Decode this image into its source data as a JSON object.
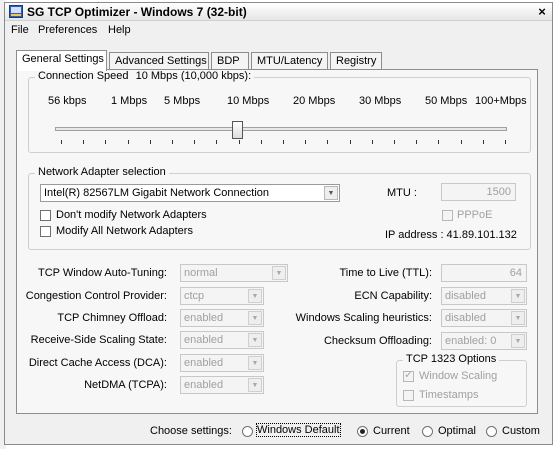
{
  "window": {
    "title": "SG TCP Optimizer - Windows 7 (32-bit)",
    "close_glyph": "×"
  },
  "menu": {
    "items": [
      "File",
      "Preferences",
      "Help"
    ]
  },
  "tabs": [
    "General Settings",
    "Advanced Settings",
    "BDP",
    "MTU/Latency",
    "Registry"
  ],
  "active_tab": "General Settings",
  "connection_speed": {
    "label": "Connection Speed",
    "value_text": "10 Mbps (10,000 kbps):",
    "ticks": [
      "56 kbps",
      "1 Mbps",
      "5 Mbps",
      "10 Mbps",
      "20 Mbps",
      "30 Mbps",
      "50 Mbps",
      "100+Mbps"
    ],
    "selected": "10 Mbps"
  },
  "adapter": {
    "group_title": "Network Adapter selection",
    "selected": "Intel(R) 82567LM Gigabit Network Connection",
    "dont_modify_label": "Don't modify Network Adapters",
    "modify_all_label": "Modify All Network Adapters",
    "mtu_label": "MTU :",
    "mtu_value": "1500",
    "pppoe_label": "PPPoE",
    "ip_label": "IP address : 41.89.101.132"
  },
  "settings_left": [
    {
      "label": "TCP Window Auto-Tuning:",
      "value": "normal"
    },
    {
      "label": "Congestion Control Provider:",
      "value": "ctcp"
    },
    {
      "label": "TCP Chimney Offload:",
      "value": "enabled"
    },
    {
      "label": "Receive-Side Scaling State:",
      "value": "enabled"
    },
    {
      "label": "Direct Cache Access (DCA):",
      "value": "enabled"
    },
    {
      "label": "NetDMA (TCPA):",
      "value": "enabled"
    }
  ],
  "settings_right": [
    {
      "label": "Time to Live (TTL):",
      "value": "64"
    },
    {
      "label": "ECN Capability:",
      "value": "disabled"
    },
    {
      "label": "Windows Scaling heuristics:",
      "value": "disabled"
    },
    {
      "label": "Checksum Offloading:",
      "value": "enabled: 0"
    }
  ],
  "tcp1323": {
    "title": "TCP 1323 Options",
    "window_scaling": "Window Scaling",
    "timestamps": "Timestamps"
  },
  "bottom": {
    "choose_label": "Choose settings:",
    "options": [
      "Windows Default",
      "Current",
      "Optimal",
      "Custom"
    ],
    "selected": "Current"
  },
  "icons": {
    "app": "app-icon",
    "dropdown": "chevron-down-icon"
  },
  "colors": {
    "window_bg": "#f0f0f0",
    "panel_bg": "#f7f7f7",
    "disabled_text": "#a0a0a0"
  }
}
